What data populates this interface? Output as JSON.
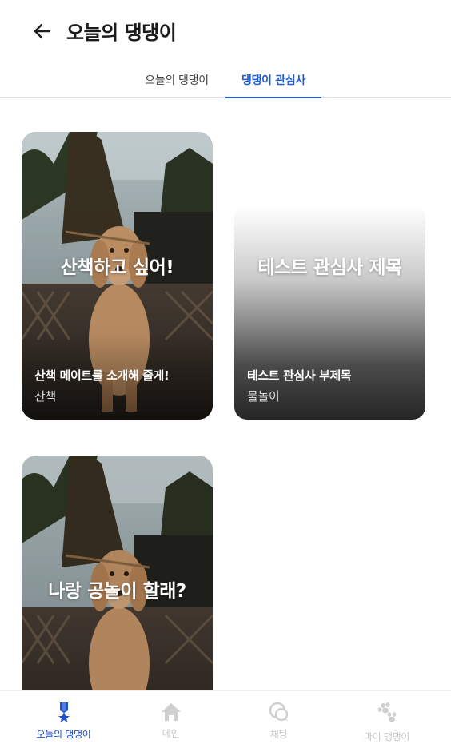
{
  "header": {
    "title": "오늘의 댕댕이",
    "back_icon": "arrow-left-icon"
  },
  "tabs": [
    {
      "label": "오늘의 댕댕이",
      "active": false
    },
    {
      "label": "댕댕이 관심사",
      "active": true
    }
  ],
  "cards": [
    {
      "title": "산책하고 싶어!",
      "subtitle": "산책 메이트를 소개해 줄게!",
      "tag": "산책",
      "image": "dog-photo"
    },
    {
      "title": "테스트 관심사 제목",
      "subtitle": "테스트 관심사 부제목",
      "tag": "물놀이",
      "image": "gray-gradient"
    },
    {
      "title": "나랑 공놀이 할래?",
      "subtitle": "",
      "tag": "",
      "image": "dog-photo"
    }
  ],
  "bottom_nav": [
    {
      "label": "오늘의 댕댕이",
      "icon": "medal-icon",
      "active": true
    },
    {
      "label": "메인",
      "icon": "home-icon",
      "active": false
    },
    {
      "label": "채팅",
      "icon": "chat-icon",
      "active": false
    },
    {
      "label": "마이 댕댕이",
      "icon": "paw-icon",
      "active": false
    }
  ],
  "colors": {
    "accent": "#1c5fd8",
    "nav_active": "#1c4fc7",
    "nav_inactive": "#c6c6c6"
  }
}
